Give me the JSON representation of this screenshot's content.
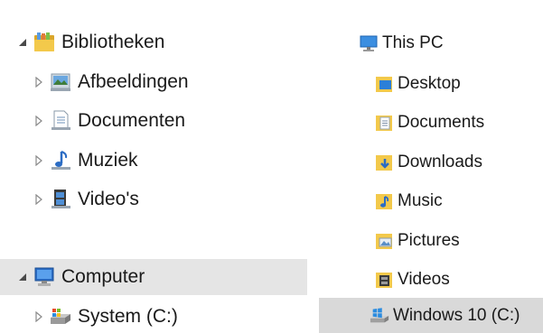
{
  "left_tree": {
    "libraries": {
      "label": "Bibliotheken",
      "icon": "library-folder-icon",
      "expanded": true,
      "children": [
        {
          "label": "Afbeeldingen",
          "icon": "pictures-library-icon",
          "expanded": false
        },
        {
          "label": "Documenten",
          "icon": "documents-library-icon",
          "expanded": false
        },
        {
          "label": "Muziek",
          "icon": "music-library-icon",
          "expanded": false
        },
        {
          "label": "Video's",
          "icon": "videos-library-icon",
          "expanded": false
        }
      ]
    },
    "computer": {
      "label": "Computer",
      "icon": "computer-icon",
      "expanded": true,
      "selected": true,
      "children": [
        {
          "label": "System (C:)",
          "icon": "system-drive-icon",
          "expanded": false
        }
      ]
    }
  },
  "right_tree": {
    "this_pc": {
      "label": "This PC",
      "icon": "this-pc-icon"
    },
    "items": [
      {
        "label": "Desktop",
        "icon": "desktop-folder-icon"
      },
      {
        "label": "Documents",
        "icon": "documents-folder-icon"
      },
      {
        "label": "Downloads",
        "icon": "downloads-folder-icon"
      },
      {
        "label": "Music",
        "icon": "music-folder-icon"
      },
      {
        "label": "Pictures",
        "icon": "pictures-folder-icon"
      },
      {
        "label": "Videos",
        "icon": "videos-folder-icon"
      }
    ],
    "drive": {
      "label": "Windows 10 (C:)",
      "icon": "windows-drive-icon",
      "selected": true
    }
  },
  "colors": {
    "folder_yellow": "#f3c94b",
    "folder_dark": "#d9a62a",
    "computer_blue": "#2b6cc4",
    "selection_left": "#e5e5e5",
    "selection_right": "#d9d9d9",
    "arrow_gray": "#6b6b6b"
  }
}
